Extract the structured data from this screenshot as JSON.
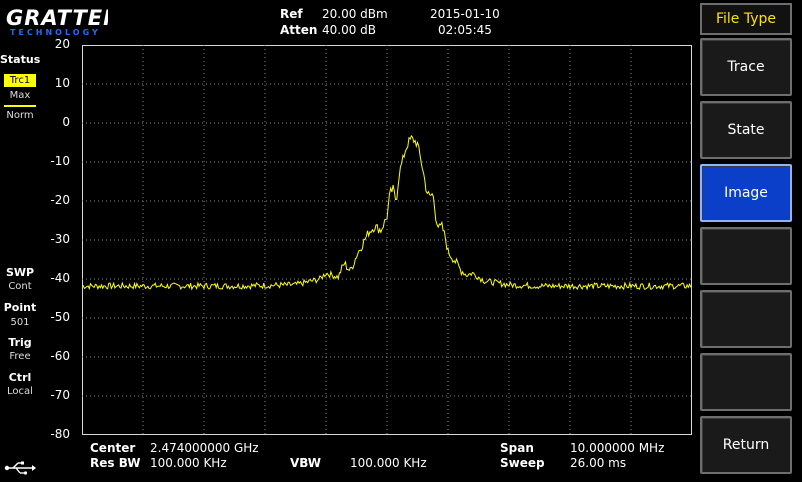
{
  "brand": {
    "name": "GRATTEN",
    "sub": "TECHNOLOGY"
  },
  "header": {
    "ref_label": "Ref",
    "ref_value": "20.00 dBm",
    "atten_label": "Atten",
    "atten_value": "40.00 dB",
    "date": "2015-01-10",
    "time": "02:05:45"
  },
  "status_panel": {
    "title": "Status",
    "trace": "Trc1",
    "trace_mode": "Max",
    "trace_det": "Norm",
    "swp_label": "SWP",
    "swp_value": "Cont",
    "point_label": "Point",
    "point_value": "501",
    "trig_label": "Trig",
    "trig_value": "Free",
    "ctrl_label": "Ctrl",
    "ctrl_value": "Local",
    "usb_icon": "usb-icon"
  },
  "yaxis": {
    "ticks": [
      "20",
      "10",
      "0",
      "-10",
      "-20",
      "-30",
      "-40",
      "-50",
      "-60",
      "-70",
      "-80"
    ]
  },
  "chart_data": {
    "type": "line",
    "ylim": [
      -80,
      20
    ],
    "xlim": [
      2.469,
      2.479
    ],
    "xlabel": "",
    "ylabel": "",
    "grid": true,
    "series": [
      {
        "color": "#ffff00",
        "points": [
          [
            2.469,
            -41.8
          ],
          [
            2.4715,
            -41.8
          ],
          [
            2.4725,
            -41.5
          ],
          [
            2.4729,
            -40
          ],
          [
            2.473,
            -38.5
          ],
          [
            2.4732,
            -39.5
          ],
          [
            2.4733,
            -36
          ],
          [
            2.4734,
            -38
          ],
          [
            2.4735,
            -34
          ],
          [
            2.4736,
            -31
          ],
          [
            2.4737,
            -28
          ],
          [
            2.4738,
            -26.5
          ],
          [
            2.4739,
            -27.5
          ],
          [
            2.474,
            -24
          ],
          [
            2.47405,
            -18
          ],
          [
            2.4741,
            -17
          ],
          [
            2.47415,
            -20
          ],
          [
            2.4742,
            -13
          ],
          [
            2.47425,
            -10
          ],
          [
            2.4743,
            -7
          ],
          [
            2.47435,
            -5
          ],
          [
            2.4744,
            -4
          ],
          [
            2.47445,
            -4.5
          ],
          [
            2.4745,
            -5.5
          ],
          [
            2.47455,
            -9
          ],
          [
            2.4746,
            -13
          ],
          [
            2.47465,
            -17.5
          ],
          [
            2.4747,
            -19
          ],
          [
            2.47475,
            -18
          ],
          [
            2.4748,
            -24
          ],
          [
            2.47485,
            -27
          ],
          [
            2.4749,
            -26.5
          ],
          [
            2.47495,
            -29
          ],
          [
            2.475,
            -33
          ],
          [
            2.4751,
            -35
          ],
          [
            2.4752,
            -37.5
          ],
          [
            2.4753,
            -39
          ],
          [
            2.4754,
            -38.5
          ],
          [
            2.4756,
            -40.5
          ],
          [
            2.476,
            -41.5
          ],
          [
            2.4765,
            -41.8
          ],
          [
            2.479,
            -41.8
          ]
        ]
      }
    ]
  },
  "bottom": {
    "center_label": "Center",
    "center_value": "2.474000000 GHz",
    "resbw_label": "Res BW",
    "resbw_value": "100.000 KHz",
    "vbw_label": "VBW",
    "vbw_value": "100.000 KHz",
    "span_label": "Span",
    "span_value": "10.000000 MHz",
    "sweep_label": "Sweep",
    "sweep_value": "26.00 ms"
  },
  "softkeys": {
    "title": "File Type",
    "items": [
      {
        "label": "Trace",
        "active": false
      },
      {
        "label": "State",
        "active": false
      },
      {
        "label": "Image",
        "active": true
      },
      {
        "label": "",
        "active": false
      },
      {
        "label": "",
        "active": false
      },
      {
        "label": "",
        "active": false
      },
      {
        "label": "Return",
        "active": false
      }
    ]
  }
}
